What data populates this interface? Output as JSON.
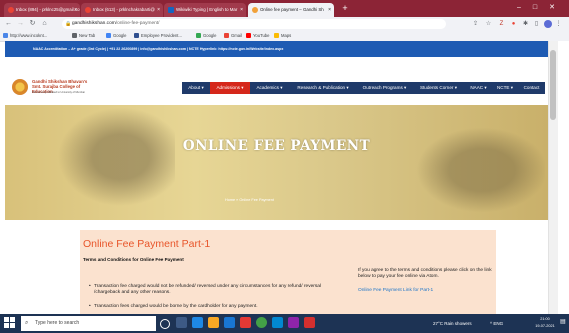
{
  "browser": {
    "tabs": [
      {
        "label": "Inbox (894) - prklnc25@gmail.co",
        "icon": "gmail-icon",
        "active": false
      },
      {
        "label": "Inbox (613) - prklnchakrabarti@",
        "icon": "gmail-icon",
        "active": false
      },
      {
        "label": "Wikiwiki Typing | English to Mar",
        "icon": "wiki-icon",
        "active": false
      },
      {
        "label": "Online fee payment – Gandhi Sh",
        "icon": "site-icon",
        "active": true
      }
    ],
    "new_tab_glyph": "+",
    "url_domain": "gandhishikshan.com",
    "url_path": "/online-fee-payment/",
    "bookmarks": [
      {
        "label": "http://www.incoknt...",
        "color": "#4a86e8"
      },
      {
        "label": "New Tab",
        "color": "#5f6368"
      },
      {
        "label": "Google",
        "color": "#4285f4"
      },
      {
        "label": "Employee Provident...",
        "color": "#2f4f8f"
      },
      {
        "label": "Google",
        "color": "#34a853"
      },
      {
        "label": "Gmail",
        "color": "#ea4335"
      },
      {
        "label": "YouTube",
        "color": "#ff0000"
      },
      {
        "label": "Maps",
        "color": "#fbbc04"
      }
    ]
  },
  "site": {
    "accreditation": "NAAC Accreditation – A+ grade (3rd Cycle) | +91 22 26200899 | info@gandhishikshan.com | NCTE Hyperlink: https://ncte.gov.in/Website/index.aspx",
    "logo_title": "Gandhi Shikshan Bhavan's Smt. Surajba College of Education",
    "logo_sub": "Permanently affiliated to University of Mumbai",
    "menu": [
      {
        "label": "About ▾",
        "active": false
      },
      {
        "label": "Admissions ▾",
        "active": true
      },
      {
        "label": "Academics ▾",
        "active": false
      },
      {
        "label": "Research & Publication ▾",
        "active": false
      },
      {
        "label": "Outreach Programs ▾",
        "active": false
      },
      {
        "label": "Students Corner ▾",
        "active": false
      },
      {
        "label": "NAAC ▾",
        "active": false
      },
      {
        "label": "NCTE ▾",
        "active": false
      },
      {
        "label": "Contact",
        "active": false
      }
    ],
    "banner_title": "ONLINE FEE PAYMENT",
    "banner_breadcrumb": "Home  »  Online Fee Payment",
    "content": {
      "heading": "Online Fee Payment Part-1",
      "terms_title": "Terms and Conditions for Online Fee Payment",
      "bullets": [
        "Transaction fee charged would not be refunded/ reversed under any circumstances for any refund/ reversal /chargeback and any other reasons.",
        "Transaction fees charged would be borne by the cardholder for any payment."
      ],
      "agree_text": "If you agree to the terms and conditions please click on the link below to pay your fee online via Atom.",
      "pay_link": "Online Fee Payment Link for Part-1"
    }
  },
  "taskbar": {
    "search_placeholder": "Type here to search",
    "weather": "27°C  Rain showers",
    "tray": "^  ENG",
    "time": "21:00",
    "date": "19-07-2021"
  },
  "colors": {
    "tab_bar": "#8c2436",
    "top_strip": "#1e5bb3",
    "menu_bg": "#1f3a6a",
    "menu_active": "#d5271b",
    "heading": "#e8552a",
    "content_box": "#fbe2cf",
    "taskbar": "#1d3354"
  }
}
